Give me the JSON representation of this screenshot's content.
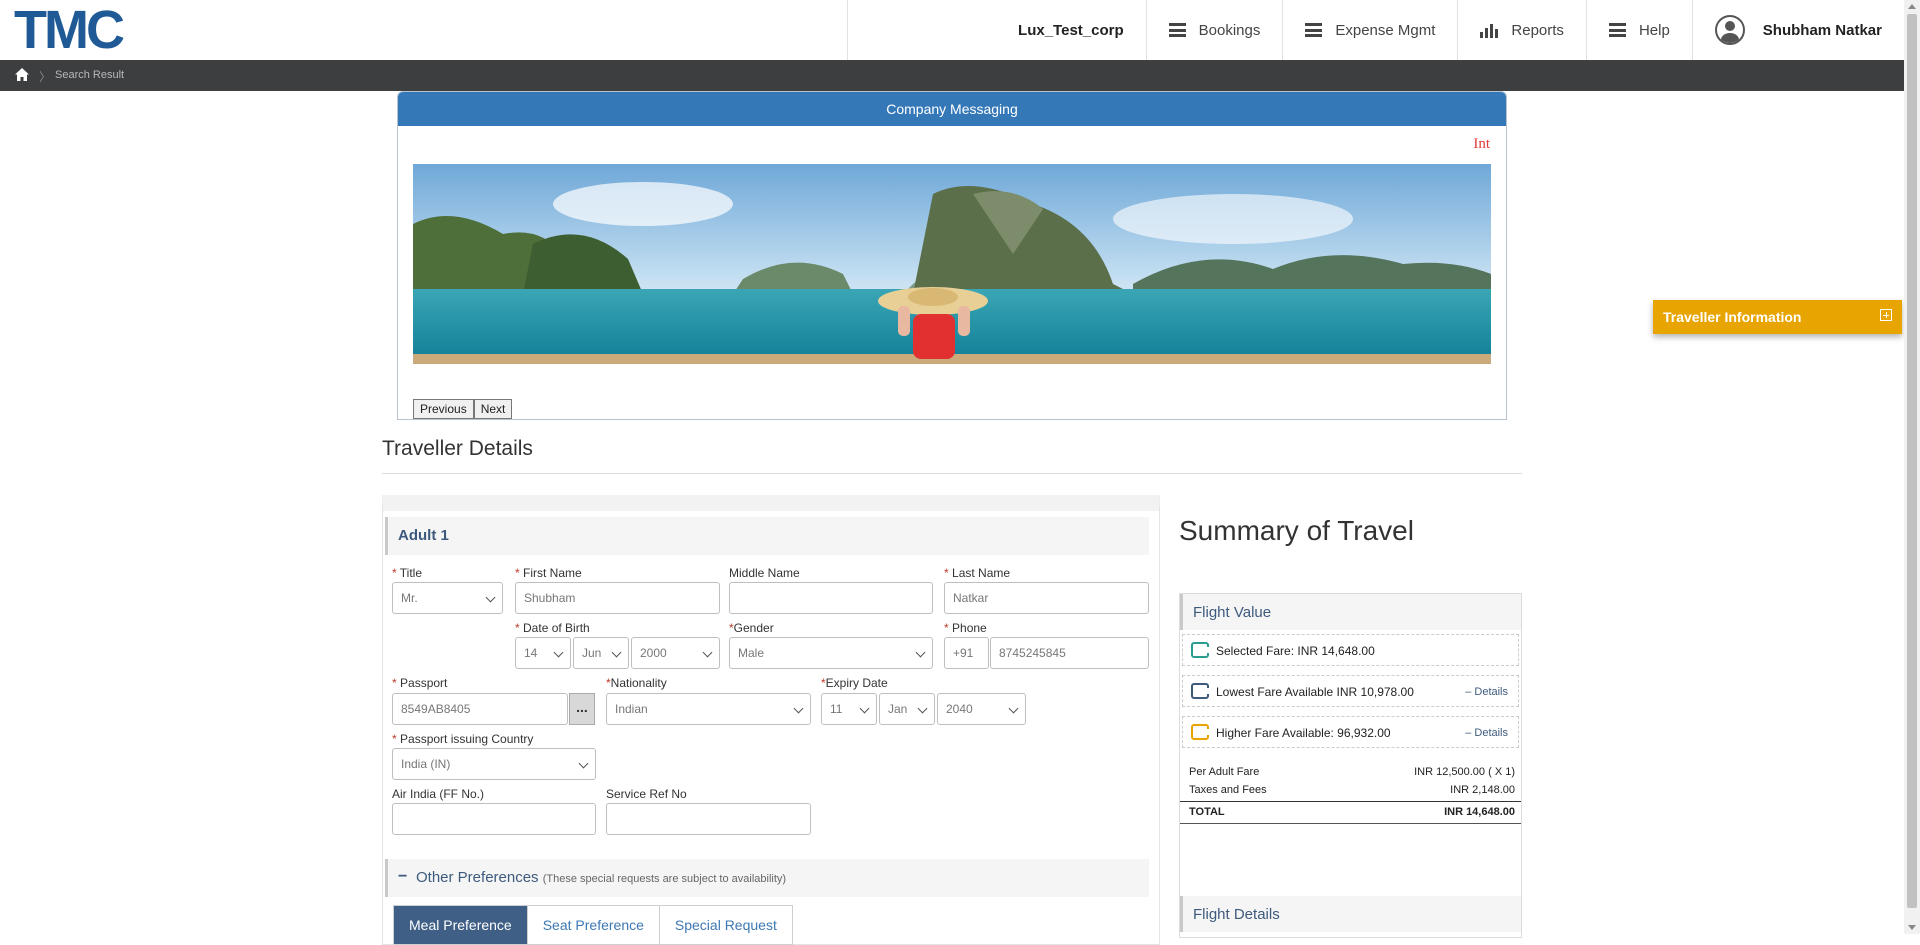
{
  "header": {
    "logo": "TMC",
    "corp": "Lux_Test_corp",
    "nav": [
      {
        "label": "Bookings",
        "icon": "menu-icon"
      },
      {
        "label": "Expense Mgmt",
        "icon": "menu-icon"
      },
      {
        "label": "Reports",
        "icon": "bar-chart-icon"
      },
      {
        "label": "Help",
        "icon": "menu-icon"
      }
    ],
    "user": "Shubham Natkar"
  },
  "breadcrumb": {
    "current": "Search Result"
  },
  "messaging": {
    "title": "Company Messaging",
    "marquee": "Int",
    "prev": "Previous",
    "next": "Next"
  },
  "traveller": {
    "section_title": "Traveller Details",
    "adult_label": "Adult 1",
    "fields": {
      "title_label": "Title",
      "title_value": "Mr.",
      "first_label": "First Name",
      "first_value": "Shubham",
      "middle_label": "Middle Name",
      "middle_value": "",
      "last_label": "Last Name",
      "last_value": "Natkar",
      "dob_label": "Date of Birth",
      "dob_day": "14",
      "dob_month": "Jun",
      "dob_year": "2000",
      "gender_label": "Gender",
      "gender_value": "Male",
      "phone_label": "Phone",
      "phone_code": "+91",
      "phone_value": "8745245845",
      "passport_label": "Passport",
      "passport_value": "8549AB8405",
      "passport_btn": "...",
      "nationality_label": "Nationality",
      "nationality_value": "Indian",
      "expiry_label": "Expiry Date",
      "expiry_day": "11",
      "expiry_month": "Jan",
      "expiry_year": "2040",
      "issuing_label": "Passport issuing Country",
      "issuing_value": "India (IN)",
      "ff_label": "Air India (FF No.)",
      "ff_value": "",
      "ref_label": "Service Ref No",
      "ref_value": ""
    },
    "preferences": {
      "title": "Other Preferences",
      "note": "(These special requests are subject to availability)",
      "tabs": [
        "Meal Preference",
        "Seat Preference",
        "Special Request"
      ],
      "active_tab": "Meal Preference"
    }
  },
  "summary": {
    "title": "Summary of Travel",
    "flight_value_title": "Flight Value",
    "fares": [
      {
        "text": "Selected Fare: INR 14,648.00",
        "link": "",
        "color": "#2a9d8f"
      },
      {
        "text": "Lowest Fare Available INR 10,978.00",
        "link": "– Details",
        "color": "#3d5a7d"
      },
      {
        "text": "Higher Fare Available: 96,932.00",
        "link": "– Details",
        "color": "#e8a400"
      }
    ],
    "breakdown": [
      {
        "label": "Per Adult Fare",
        "value": "INR 12,500.00 ( X 1)"
      },
      {
        "label": "Taxes and Fees",
        "value": "INR 2,148.00"
      },
      {
        "label": "TOTAL",
        "value": "INR 14,648.00"
      }
    ],
    "flight_details_title": "Flight Details"
  },
  "side_tab": {
    "label": "Traveller Information"
  },
  "colors": {
    "brand": "#1f5a96",
    "header_blue": "#3478b8",
    "accent_orange": "#e8a400",
    "tab_active": "#3f5f86"
  }
}
